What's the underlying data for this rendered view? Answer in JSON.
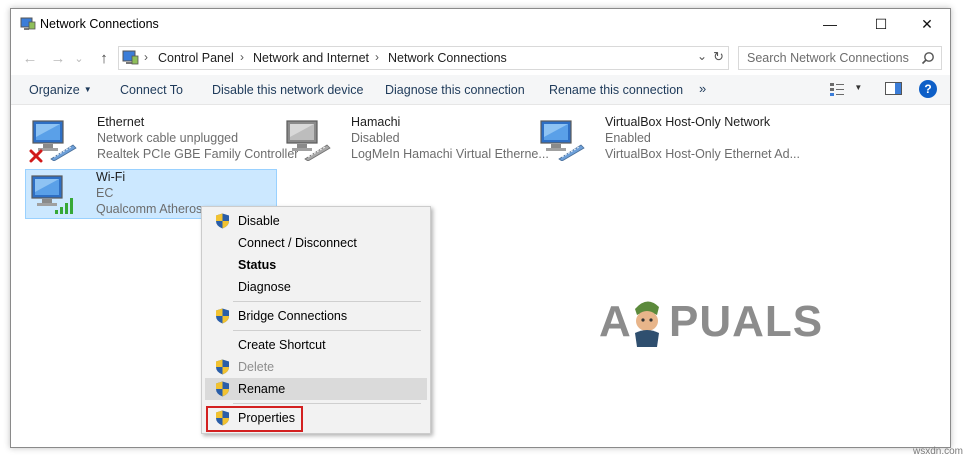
{
  "window": {
    "title": "Network Connections",
    "minimize_label": "—",
    "maximize_label": "☐",
    "close_label": "✕"
  },
  "nav": {
    "back_label": "←",
    "forward_label": "→",
    "history_label": "⌄",
    "up_label": "↑"
  },
  "address": {
    "breadcrumbs": [
      "Control Panel",
      "Network and Internet",
      "Network Connections"
    ],
    "separator": "›",
    "dropdown_label": "⌄",
    "refresh_label": "↻"
  },
  "search": {
    "placeholder": "Search Network Connections"
  },
  "toolbar": {
    "organize_label": "Organize",
    "organize_caret": "▼",
    "connect_to_label": "Connect To",
    "disable_device_label": "Disable this network device",
    "diagnose_label": "Diagnose this connection",
    "rename_label": "Rename this connection",
    "more_label": "»",
    "view_caret": "▼",
    "help_label": "?"
  },
  "connections": [
    {
      "name": "Ethernet",
      "status": "Network cable unplugged",
      "device": "Realtek PCIe GBE Family Controller",
      "state": "unplugged"
    },
    {
      "name": "Hamachi",
      "status": "Disabled",
      "device": "LogMeIn Hamachi Virtual Etherne...",
      "state": "disabled"
    },
    {
      "name": "VirtualBox Host-Only Network",
      "status": "Enabled",
      "device": "VirtualBox Host-Only Ethernet Ad...",
      "state": "enabled"
    },
    {
      "name": "Wi-Fi",
      "status": "EC",
      "device": "Qualcomm Atheros AR956x Wireless Network Adapter",
      "state": "wifi",
      "selected": true
    }
  ],
  "context_menu": {
    "items": [
      {
        "label": "Disable",
        "icon": "shield-icon",
        "style": "normal"
      },
      {
        "label": "Connect / Disconnect",
        "icon": "",
        "style": "normal"
      },
      {
        "label": "Status",
        "icon": "",
        "style": "bold"
      },
      {
        "label": "Diagnose",
        "icon": "",
        "style": "normal"
      },
      {
        "label": "Bridge Connections",
        "icon": "shield-icon",
        "style": "normal"
      },
      {
        "label": "Create Shortcut",
        "icon": "",
        "style": "normal"
      },
      {
        "label": "Delete",
        "icon": "shield-icon",
        "style": "disabled"
      },
      {
        "label": "Rename",
        "icon": "shield-icon",
        "style": "hover"
      },
      {
        "label": "Properties",
        "icon": "shield-icon",
        "style": "highlighted"
      }
    ]
  },
  "watermark": {
    "logo_left": "A",
    "logo_right": "PUALS",
    "site": "wsxdn.com"
  },
  "colors": {
    "accent": "#0078d7",
    "selection_bg": "#cce8ff",
    "highlight_border": "#d32020",
    "shield_blue": "#2a5ea8",
    "shield_yellow": "#f2c230"
  }
}
